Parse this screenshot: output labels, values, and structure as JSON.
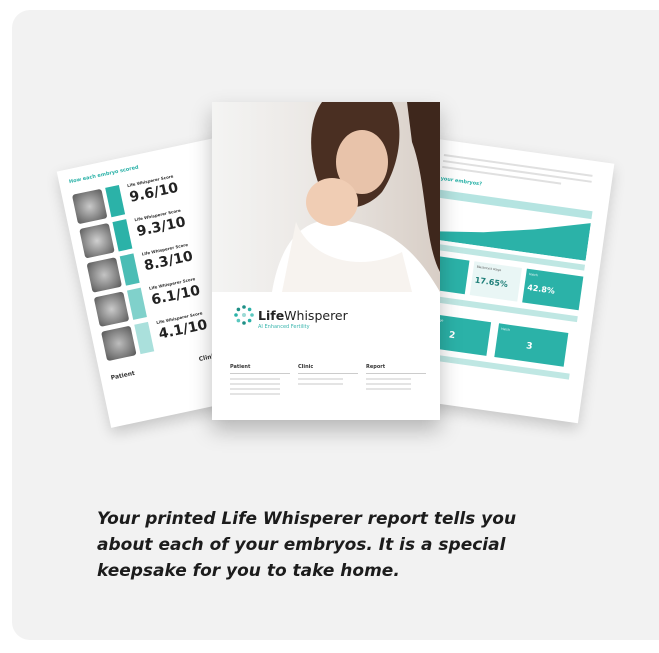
{
  "caption": "Your printed Life Whisperer report tells you about each of your embryos. It is a special keepsake for you to take home.",
  "report": {
    "brand_name_bold": "Life",
    "brand_name_light": "Whisperer",
    "brand_tagline": "AI Enhanced Fertility",
    "sections": [
      "Patient",
      "Clinic",
      "Report"
    ]
  },
  "left_page": {
    "heading": "How each embryo scored",
    "score_label": "Life Whisperer Score",
    "scores": [
      "9.6/10",
      "9.3/10",
      "8.3/10",
      "6.1/10",
      "4.1/10"
    ],
    "patient_heading": "Patient",
    "clinic_heading": "Clinic"
  },
  "right_page": {
    "heading": "your embryos?",
    "boxes": [
      {
        "label": "Blastocyst stage",
        "value": "17.65%"
      },
      {
        "label": "Hatch",
        "value": "42.8%"
      },
      {
        "label": "Morula stage",
        "value": "2"
      },
      {
        "label": "Hatch",
        "value": "3"
      }
    ]
  },
  "colors": {
    "accent": "#2bb2a8",
    "card": "#f2f2f2"
  }
}
